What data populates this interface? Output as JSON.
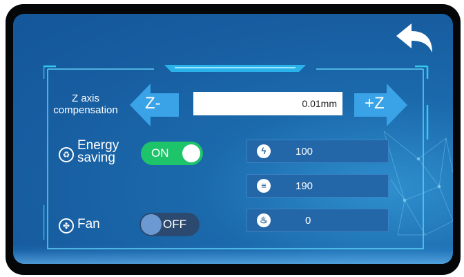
{
  "colors": {
    "screen_background": "#175da0",
    "toggle_on": "#1ec46a",
    "toggle_off": "#2c4a70",
    "field_background": "#2367a8",
    "accent_cyan": "#35c8f0"
  },
  "header": {
    "back_icon": "back-arrow-icon"
  },
  "z_compensation": {
    "label": "Z axis compensation",
    "decrease_label": "Z-",
    "increase_label": "+Z",
    "value": "0.01mm"
  },
  "energy_saving": {
    "icon": "recycle-icon",
    "label": "Energy saving",
    "toggle_label": "ON",
    "state": true
  },
  "fan": {
    "icon": "fan-icon",
    "label": "Fan",
    "toggle_label": "OFF",
    "state": false
  },
  "parameters": [
    {
      "icon": "lightning-icon",
      "value": "100"
    },
    {
      "icon": "layer-height-icon",
      "value": "190"
    },
    {
      "icon": "heat-icon",
      "value": "0"
    }
  ]
}
